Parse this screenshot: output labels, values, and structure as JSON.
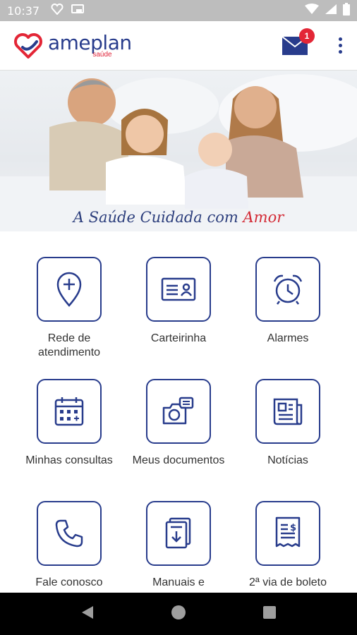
{
  "status_bar": {
    "time": "10:37",
    "icons": [
      "heart-badge-icon",
      "cast-icon",
      "wifi-icon",
      "signal-icon",
      "battery-icon"
    ]
  },
  "app_bar": {
    "logo_name": "ameplan",
    "logo_sub": "saúde",
    "notification_count": "1",
    "icons": [
      "mail-icon",
      "more-vert-icon"
    ]
  },
  "banner": {
    "caption_main": "A Saúde Cuidada com ",
    "caption_accent": "Amor"
  },
  "menu": {
    "items": [
      {
        "label": "Rede de atendimento",
        "icon": "location-plus-icon"
      },
      {
        "label": "Carteirinha",
        "icon": "id-card-icon"
      },
      {
        "label": "Alarmes",
        "icon": "alarm-clock-icon"
      },
      {
        "label": "Minhas consultas",
        "icon": "calendar-icon"
      },
      {
        "label": "Meus documentos",
        "icon": "camera-documents-icon"
      },
      {
        "label": "Notícias",
        "icon": "newspaper-icon"
      },
      {
        "label": "Fale conosco",
        "icon": "phone-icon"
      },
      {
        "label": "Manuais e",
        "icon": "manual-download-icon"
      },
      {
        "label": "2ª via de boleto",
        "icon": "receipt-icon"
      }
    ]
  },
  "colors": {
    "brand_blue": "#283c8c",
    "brand_red": "#e32636",
    "status_bar": "#bdbdbd"
  },
  "nav_bar": {
    "icons": [
      "back-icon",
      "home-icon",
      "recents-icon"
    ]
  }
}
